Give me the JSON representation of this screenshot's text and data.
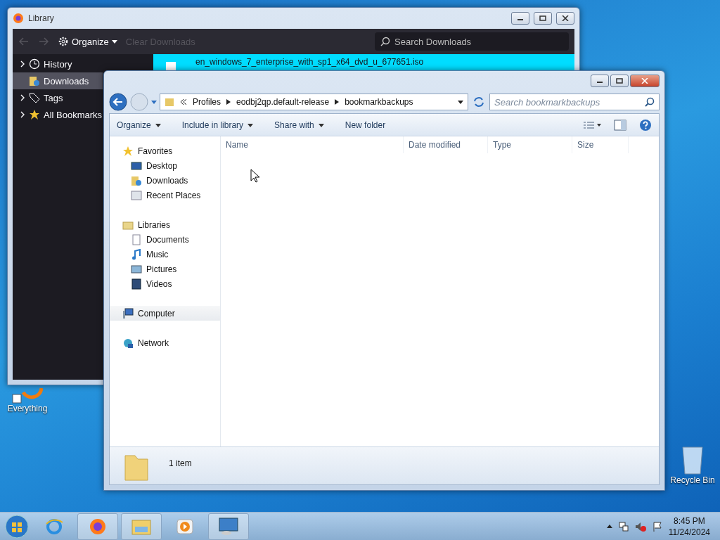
{
  "library": {
    "title": "Library",
    "organize": "Organize",
    "clear": {
      "label": "Clear Downloads",
      "disabled": true
    },
    "search": {
      "placeholder": "Search Downloads"
    },
    "sidebar": [
      {
        "label": "History",
        "kind": "clock",
        "expandable": true,
        "selected": false
      },
      {
        "label": "Downloads",
        "kind": "download",
        "expandable": false,
        "selected": true
      },
      {
        "label": "Tags",
        "kind": "tag",
        "expandable": true,
        "selected": false
      },
      {
        "label": "All Bookmarks",
        "kind": "star",
        "expandable": true,
        "selected": false
      }
    ],
    "downloads": [
      {
        "name": "en_windows_7_enterprise_with_sp1_x64_dvd_u_677651.iso",
        "selected": true
      }
    ]
  },
  "explorer": {
    "breadcrumb": [
      "Profiles",
      "eodbj2qp.default-release",
      "bookmarkbackups"
    ],
    "search": {
      "placeholder": "Search bookmarkbackups"
    },
    "commands": [
      {
        "label": "Organize",
        "dropdown": true
      },
      {
        "label": "Include in library",
        "dropdown": true
      },
      {
        "label": "Share with",
        "dropdown": true
      },
      {
        "label": "New folder",
        "dropdown": false
      }
    ],
    "columns": [
      "Name",
      "Date modified",
      "Type",
      "Size"
    ],
    "nav": [
      {
        "label": "Favorites",
        "kind": "star",
        "selected": false,
        "children": [
          {
            "label": "Desktop",
            "kind": "desktop",
            "selected": false
          },
          {
            "label": "Downloads",
            "kind": "download",
            "selected": false
          },
          {
            "label": "Recent Places",
            "kind": "recent",
            "selected": false
          }
        ]
      },
      {
        "label": "Libraries",
        "kind": "library",
        "selected": false,
        "children": [
          {
            "label": "Documents",
            "kind": "document",
            "selected": false
          },
          {
            "label": "Music",
            "kind": "music",
            "selected": false
          },
          {
            "label": "Pictures",
            "kind": "picture",
            "selected": false
          },
          {
            "label": "Videos",
            "kind": "video",
            "selected": false
          }
        ]
      },
      {
        "label": "Computer",
        "kind": "computer",
        "selected": true
      },
      {
        "label": "Network",
        "kind": "network",
        "selected": false
      }
    ],
    "status": "1 item"
  },
  "desktop_icons": [
    {
      "label": "Everything",
      "kind": "everything"
    },
    {
      "label": "Recycle Bin",
      "kind": "recycle"
    }
  ],
  "taskbar": {
    "apps": [
      {
        "kind": "ie",
        "open": false
      },
      {
        "kind": "firefox",
        "open": true
      },
      {
        "kind": "explorer",
        "open": true
      },
      {
        "kind": "media",
        "open": false
      },
      {
        "kind": "remote",
        "open": true
      }
    ],
    "time": "8:45 PM",
    "date": "11/24/2024"
  }
}
